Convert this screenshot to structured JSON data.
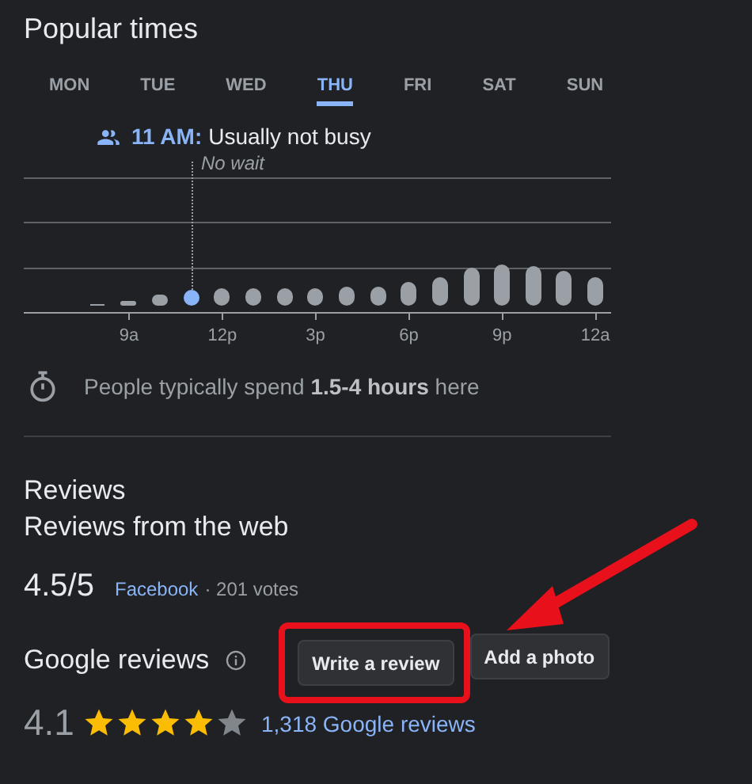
{
  "popular_times": {
    "title": "Popular times",
    "days": [
      {
        "label": "MON",
        "selected": false
      },
      {
        "label": "TUE",
        "selected": false
      },
      {
        "label": "WED",
        "selected": false
      },
      {
        "label": "THU",
        "selected": true
      },
      {
        "label": "FRI",
        "selected": false
      },
      {
        "label": "SAT",
        "selected": false
      },
      {
        "label": "SUN",
        "selected": false
      }
    ],
    "tooltip": {
      "time": "11 AM:",
      "status": "Usually not busy",
      "wait": "No wait"
    },
    "hours": [
      {
        "selected": false
      },
      {
        "selected": false,
        "label": "9a"
      },
      {
        "selected": false
      },
      {
        "selected": true
      },
      {
        "selected": false,
        "label": "12p"
      },
      {
        "selected": false
      },
      {
        "selected": false
      },
      {
        "selected": false,
        "label": "3p"
      },
      {
        "selected": false
      },
      {
        "selected": false
      },
      {
        "selected": false,
        "label": "6p"
      },
      {
        "selected": false
      },
      {
        "selected": false
      },
      {
        "selected": false,
        "label": "9p"
      },
      {
        "selected": false
      },
      {
        "selected": false
      },
      {
        "selected": false,
        "label": "12a"
      }
    ],
    "visit_duration": "People typically spend **1.5-4 hours** here"
  },
  "reviews": {
    "title": "Reviews",
    "subtitle": "Reviews from the web",
    "web": [
      {
        "score": "4.5/5",
        "source": "Facebook",
        "votes": "· 201 votes"
      }
    ],
    "google": {
      "title": "Google reviews",
      "buttons": [
        {
          "label": "Write a review",
          "highlighted": true
        },
        {
          "label": "Add a photo",
          "highlighted": false
        }
      ],
      "rating": "4.1",
      "stars": 4,
      "count": "1,318 Google reviews"
    }
  }
}
